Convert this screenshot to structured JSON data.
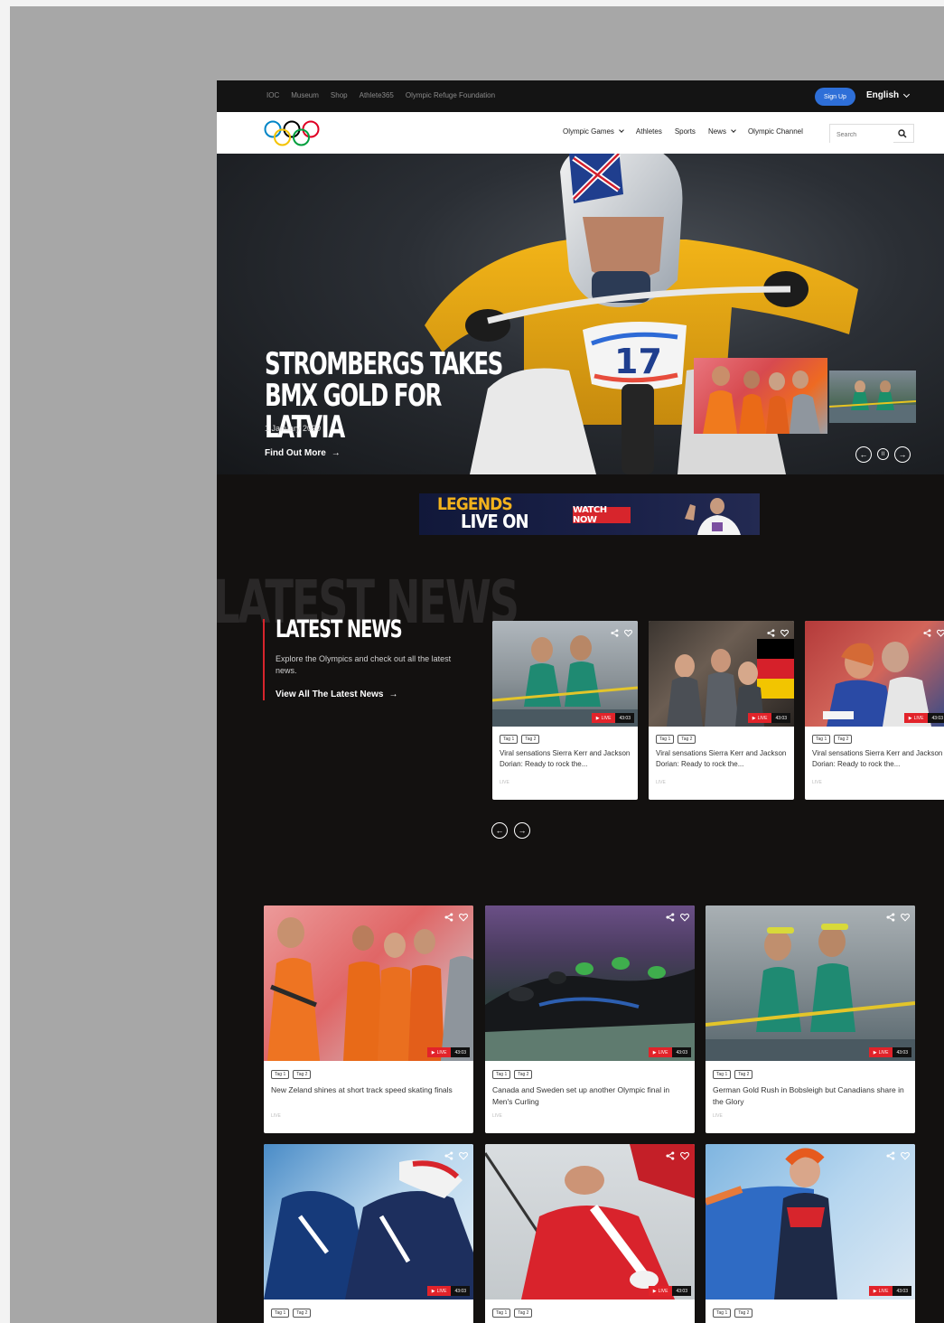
{
  "utility_nav": {
    "links": [
      "IOC",
      "Museum",
      "Shop",
      "Athlete365",
      "Olympic Refuge Foundation"
    ],
    "signup_label": "Sign Up",
    "language": "English"
  },
  "main_nav": {
    "items": [
      "Olympic Games",
      "Athletes",
      "Sports",
      "News",
      "Olympic Channel"
    ],
    "search_placeholder": "Search"
  },
  "hero": {
    "title": "STROMBERGS TAKES BMX GOLD FOR LATVIA",
    "date": "1 January 2020",
    "cta": "Find Out More",
    "bib_number": "17",
    "pause_glyph": "II"
  },
  "banner": {
    "line1": "LEGENDS",
    "line2": "LIVE ON",
    "cta": "WATCH NOW"
  },
  "latest_news": {
    "ghost_title": "LATEST NEWS",
    "title": "LATEST NEWS",
    "description": "Explore the Olympics and check out all the latest news.",
    "cta": "View All The Latest News",
    "cards": [
      {
        "tag1": "Tag 1",
        "tag2": "Tag 2",
        "title": "Viral sensations Sierra Kerr and Jackson Dorian: Ready to rock the...",
        "live": "LIVE",
        "time": "43:03",
        "footer": "LIVE"
      },
      {
        "tag1": "Tag 1",
        "tag2": "Tag 2",
        "title": "Viral sensations Sierra Kerr and Jackson Dorian: Ready to rock the...",
        "live": "LIVE",
        "time": "43:03",
        "footer": "LIVE"
      },
      {
        "tag1": "Tag 1",
        "tag2": "Tag 2",
        "title": "Viral sensations Sierra Kerr and Jackson Dorian: Ready to rock the...",
        "live": "LIVE",
        "time": "43:03",
        "footer": "LIVE"
      }
    ]
  },
  "grid": {
    "cards": [
      {
        "tag1": "Tag 1",
        "tag2": "Tag 2",
        "title": "New Zeland shines at short track speed skating finals",
        "live": "LIVE",
        "time": "43:03",
        "footer": "LIVE"
      },
      {
        "tag1": "Tag 1",
        "tag2": "Tag 2",
        "title": "Canada and Sweden set up another Olympic final in Men's Curling",
        "live": "LIVE",
        "time": "43:03",
        "footer": "LIVE"
      },
      {
        "tag1": "Tag 1",
        "tag2": "Tag 2",
        "title": "German Gold Rush in Bobsleigh but Canadians share in the Glory",
        "live": "LIVE",
        "time": "43:03",
        "footer": "LIVE"
      },
      {
        "tag1": "Tag 1",
        "tag2": "Tag 2",
        "title": "",
        "live": "LIVE",
        "time": "43:03",
        "footer": ""
      },
      {
        "tag1": "Tag 1",
        "tag2": "Tag 2",
        "title": "",
        "live": "LIVE",
        "time": "43:03",
        "footer": ""
      },
      {
        "tag1": "Tag 1",
        "tag2": "Tag 2",
        "title": "",
        "live": "LIVE",
        "time": "43:03",
        "footer": ""
      }
    ]
  },
  "colors": {
    "accent_red": "#e2232a",
    "signup_blue": "#2e6fd8",
    "page_dark": "#131110",
    "ring_blue": "#0085c7",
    "ring_yellow": "#f4c300",
    "ring_black": "#000000",
    "ring_green": "#009f3d",
    "ring_red": "#df0024"
  }
}
